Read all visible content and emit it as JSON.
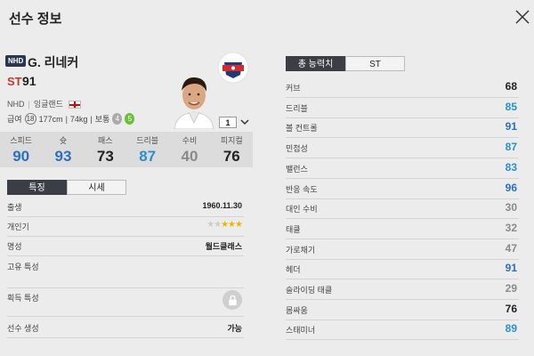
{
  "window": {
    "title": "선수 정보",
    "close_icon": "close-icon"
  },
  "player": {
    "season_badge": "NHD",
    "name": "G. 리네커",
    "position": "ST",
    "ovr": "91",
    "season_code": "NHD",
    "country": "잉글랜드",
    "pay": "18",
    "height": "177cm",
    "weight": "74kg",
    "body": "보통",
    "left_foot": "4",
    "right_foot": "5",
    "level": "1"
  },
  "stats": [
    {
      "label": "스피드",
      "value": "90",
      "color": "#2a6fc2"
    },
    {
      "label": "슛",
      "value": "93",
      "color": "#2a6fc2"
    },
    {
      "label": "패스",
      "value": "73",
      "color": "#222222"
    },
    {
      "label": "드리블",
      "value": "87",
      "color": "#2a8fd0"
    },
    {
      "label": "수비",
      "value": "40",
      "color": "#8a8a8a"
    },
    {
      "label": "피지컬",
      "value": "76",
      "color": "#222222"
    }
  ],
  "left_tabs": {
    "traits": "특징",
    "market": "시세"
  },
  "details": {
    "birth_label": "출생",
    "birth_value": "1960.11.30",
    "popularity_label": "개인기",
    "popularity_stars_off": "★★",
    "popularity_stars_on": "★★★",
    "reputation_label": "명성",
    "reputation_value": "월드클래스",
    "unique_label": "고유 특성",
    "acquired_label": "획득 특성",
    "create_label": "선수 생성",
    "create_value": "가능"
  },
  "right_tabs": {
    "total": "총 능력치",
    "pos": "ST"
  },
  "abilities": [
    {
      "label": "커브",
      "value": "68",
      "color": "#222222"
    },
    {
      "label": "드리블",
      "value": "85",
      "color": "#2a8fd0"
    },
    {
      "label": "볼 컨트롤",
      "value": "91",
      "color": "#2a6fc2"
    },
    {
      "label": "민첩성",
      "value": "87",
      "color": "#2a8fd0"
    },
    {
      "label": "밸런스",
      "value": "83",
      "color": "#2a8fd0"
    },
    {
      "label": "반응 속도",
      "value": "96",
      "color": "#2a6fc2"
    },
    {
      "label": "대인 수비",
      "value": "30",
      "color": "#8a8a8a"
    },
    {
      "label": "태클",
      "value": "32",
      "color": "#8a8a8a"
    },
    {
      "label": "가로채기",
      "value": "47",
      "color": "#8a8a8a"
    },
    {
      "label": "헤더",
      "value": "91",
      "color": "#2a6fc2"
    },
    {
      "label": "슬라이딩 태클",
      "value": "29",
      "color": "#8a8a8a"
    },
    {
      "label": "몸싸움",
      "value": "76",
      "color": "#222222"
    },
    {
      "label": "스태미너",
      "value": "89",
      "color": "#2a8fd0"
    }
  ]
}
